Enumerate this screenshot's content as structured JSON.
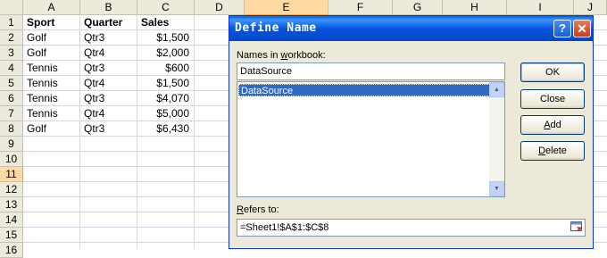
{
  "sheet": {
    "columns": [
      "A",
      "B",
      "C",
      "D",
      "E",
      "F",
      "G",
      "H",
      "I",
      "J"
    ],
    "selected_column": "E",
    "rows": [
      "1",
      "2",
      "3",
      "4",
      "5",
      "6",
      "7",
      "8",
      "9",
      "10",
      "11",
      "12",
      "13",
      "14",
      "15",
      "16"
    ],
    "selected_row": "11",
    "header": [
      "Sport",
      "Quarter",
      "Sales"
    ],
    "data": [
      [
        "Golf",
        "Qtr3",
        "$1,500"
      ],
      [
        "Golf",
        "Qtr4",
        "$2,000"
      ],
      [
        "Tennis",
        "Qtr3",
        "$600"
      ],
      [
        "Tennis",
        "Qtr4",
        "$1,500"
      ],
      [
        "Tennis",
        "Qtr3",
        "$4,070"
      ],
      [
        "Tennis",
        "Qtr4",
        "$5,000"
      ],
      [
        "Golf",
        "Qtr3",
        "$6,430"
      ]
    ]
  },
  "dialog": {
    "title": "Define Name",
    "help_label": "?",
    "close_label": "✕",
    "names_label_pre": "Names in ",
    "names_label_ul": "w",
    "names_label_post": "orkbook:",
    "name_value": "DataSource",
    "list_items": [
      "DataSource"
    ],
    "refers_label_ul": "R",
    "refers_label_post": "efers to:",
    "refers_value": "=Sheet1!$A$1:$C$8",
    "buttons": {
      "ok": "OK",
      "close": "Close",
      "add_ul": "A",
      "add_post": "dd",
      "delete_ul": "D",
      "delete_post": "elete"
    }
  },
  "colors": {
    "title_bar": "#0855dd",
    "selection": "#316ac5",
    "dialog_bg": "#ece9d8",
    "header_bg": "#ebeadb",
    "selected_header": "#fdd9a3"
  }
}
